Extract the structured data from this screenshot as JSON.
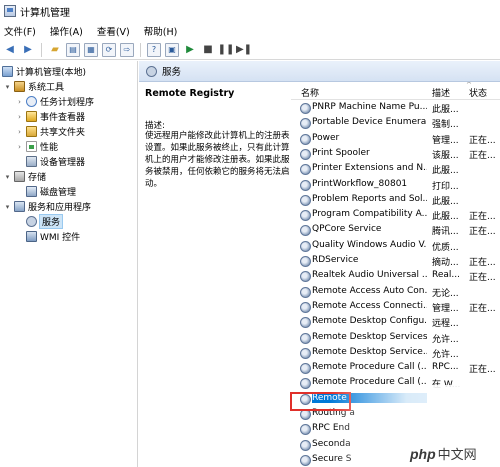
{
  "window": {
    "title": "计算机管理"
  },
  "menu": {
    "items": [
      "文件(F)",
      "操作(A)",
      "查看(V)",
      "帮助(H)"
    ]
  },
  "tree": {
    "root": "计算机管理(本地)",
    "system_tools": "系统工具",
    "task_scheduler": "任务计划程序",
    "event_viewer": "事件查看器",
    "shared_folders": "共享文件夹",
    "performance": "性能",
    "device_manager": "设备管理器",
    "storage": "存储",
    "disk_management": "磁盘管理",
    "services_apps": "服务和应用程序",
    "services": "服务",
    "wmi": "WMI 控件"
  },
  "header": {
    "title": "服务"
  },
  "detail": {
    "title": "Remote Registry",
    "desc_label": "描述:",
    "desc_text": "使远程用户能修改此计算机上的注册表设置。如果此服务被终止，只有此计算机上的用户才能修改注册表。如果此服务被禁用，任何依赖它的服务将无法启动。"
  },
  "list": {
    "columns": {
      "name": "名称",
      "desc": "描述",
      "status": "状态"
    },
    "rows": [
      {
        "name": "PNRP Machine Name Pu...",
        "desc": "此服...",
        "status": ""
      },
      {
        "name": "Portable Device Enumera...",
        "desc": "强制...",
        "status": ""
      },
      {
        "name": "Power",
        "desc": "管理...",
        "status": "正在..."
      },
      {
        "name": "Print Spooler",
        "desc": "该服...",
        "status": "正在..."
      },
      {
        "name": "Printer Extensions and N...",
        "desc": "此服...",
        "status": ""
      },
      {
        "name": "PrintWorkflow_80801",
        "desc": "打印...",
        "status": ""
      },
      {
        "name": "Problem Reports and Sol...",
        "desc": "此服...",
        "status": ""
      },
      {
        "name": "Program Compatibility A...",
        "desc": "此服...",
        "status": "正在..."
      },
      {
        "name": "QPCore Service",
        "desc": "腾讯...",
        "status": "正在..."
      },
      {
        "name": "Quality Windows Audio V...",
        "desc": "优质...",
        "status": ""
      },
      {
        "name": "RDService",
        "desc": "摘动...",
        "status": "正在..."
      },
      {
        "name": "Realtek Audio Universal ...",
        "desc": "Real...",
        "status": "正在..."
      },
      {
        "name": "Remote Access Auto Con...",
        "desc": "无论...",
        "status": ""
      },
      {
        "name": "Remote Access Connecti...",
        "desc": "管理...",
        "status": "正在..."
      },
      {
        "name": "Remote Desktop Configu...",
        "desc": "远程...",
        "status": ""
      },
      {
        "name": "Remote Desktop Services",
        "desc": "允许...",
        "status": ""
      },
      {
        "name": "Remote Desktop Service...",
        "desc": "允许...",
        "status": ""
      },
      {
        "name": "Remote Procedure Call (...",
        "desc": "RPC...",
        "status": "正在..."
      },
      {
        "name": "Remote Procedure Call (...",
        "desc": "在 W...",
        "status": ""
      },
      {
        "name": "Remote",
        "desc": "",
        "status": ""
      },
      {
        "name": "Routing a",
        "desc": "",
        "status": ""
      },
      {
        "name": "RPC End",
        "desc": "",
        "status": ""
      },
      {
        "name": "Seconda",
        "desc": "",
        "status": ""
      },
      {
        "name": "Secure S",
        "desc": "",
        "status": ""
      }
    ]
  },
  "watermark": {
    "logo": "php",
    "text": "中文网"
  },
  "icons": {
    "back": "back-arrow-icon",
    "forward": "forward-arrow-icon",
    "play": "play-icon",
    "pause": "pause-icon",
    "stop": "stop-icon",
    "restart": "restart-icon",
    "service": "gear-icon"
  }
}
